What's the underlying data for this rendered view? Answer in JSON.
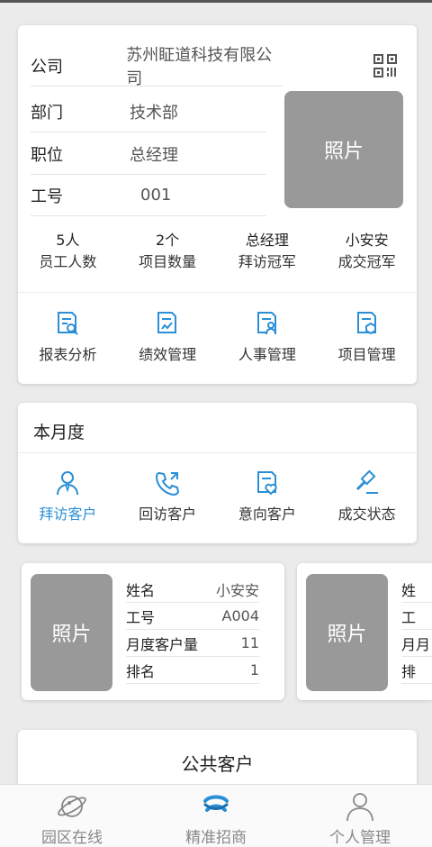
{
  "profile": {
    "rows": [
      {
        "label": "公司",
        "value": "苏州眐道科技有限公司"
      },
      {
        "label": "部门",
        "value": "技术部"
      },
      {
        "label": "职位",
        "value": "总经理"
      },
      {
        "label": "工号",
        "value": "001"
      }
    ],
    "photo_label": "照片",
    "stats": [
      {
        "value": "5人",
        "label": "员工人数"
      },
      {
        "value": "2个",
        "label": "项目数量"
      },
      {
        "value": "总经理",
        "label": "拜访冠军"
      },
      {
        "value": "小安安",
        "label": "成交冠军"
      }
    ],
    "menu": [
      {
        "label": "报表分析",
        "icon": "report-analysis-icon"
      },
      {
        "label": "绩效管理",
        "icon": "performance-icon"
      },
      {
        "label": "人事管理",
        "icon": "personnel-icon"
      },
      {
        "label": "项目管理",
        "icon": "project-icon"
      }
    ]
  },
  "month": {
    "title": "本月度",
    "menu": [
      {
        "label": "拜访客户",
        "icon": "visit-customer-icon",
        "active": true
      },
      {
        "label": "回访客户",
        "icon": "callback-phone-icon",
        "active": false
      },
      {
        "label": "意向客户",
        "icon": "intent-customer-icon",
        "active": false
      },
      {
        "label": "成交状态",
        "icon": "deal-gavel-icon",
        "active": false
      }
    ]
  },
  "ranking": [
    {
      "photo_label": "照片",
      "fields": [
        {
          "k": "姓名",
          "v": "小安安"
        },
        {
          "k": "工号",
          "v": "A004"
        },
        {
          "k": "月度客户量",
          "v": "11"
        },
        {
          "k": "排名",
          "v": "1"
        }
      ]
    },
    {
      "photo_label": "照片",
      "fields": [
        {
          "k": "姓",
          "v": ""
        },
        {
          "k": "工",
          "v": ""
        },
        {
          "k": "月月",
          "v": ""
        },
        {
          "k": "排",
          "v": ""
        }
      ]
    }
  ],
  "public": {
    "title": "公共客户"
  },
  "nav": [
    {
      "label": "园区在线",
      "icon": "planet-icon",
      "active": false
    },
    {
      "label": "精准招商",
      "icon": "app-logo-icon",
      "active": true
    },
    {
      "label": "个人管理",
      "icon": "user-icon",
      "active": false
    }
  ],
  "colors": {
    "accent": "#2a8fd6",
    "photo_bg": "#999999",
    "muted": "#888888"
  }
}
